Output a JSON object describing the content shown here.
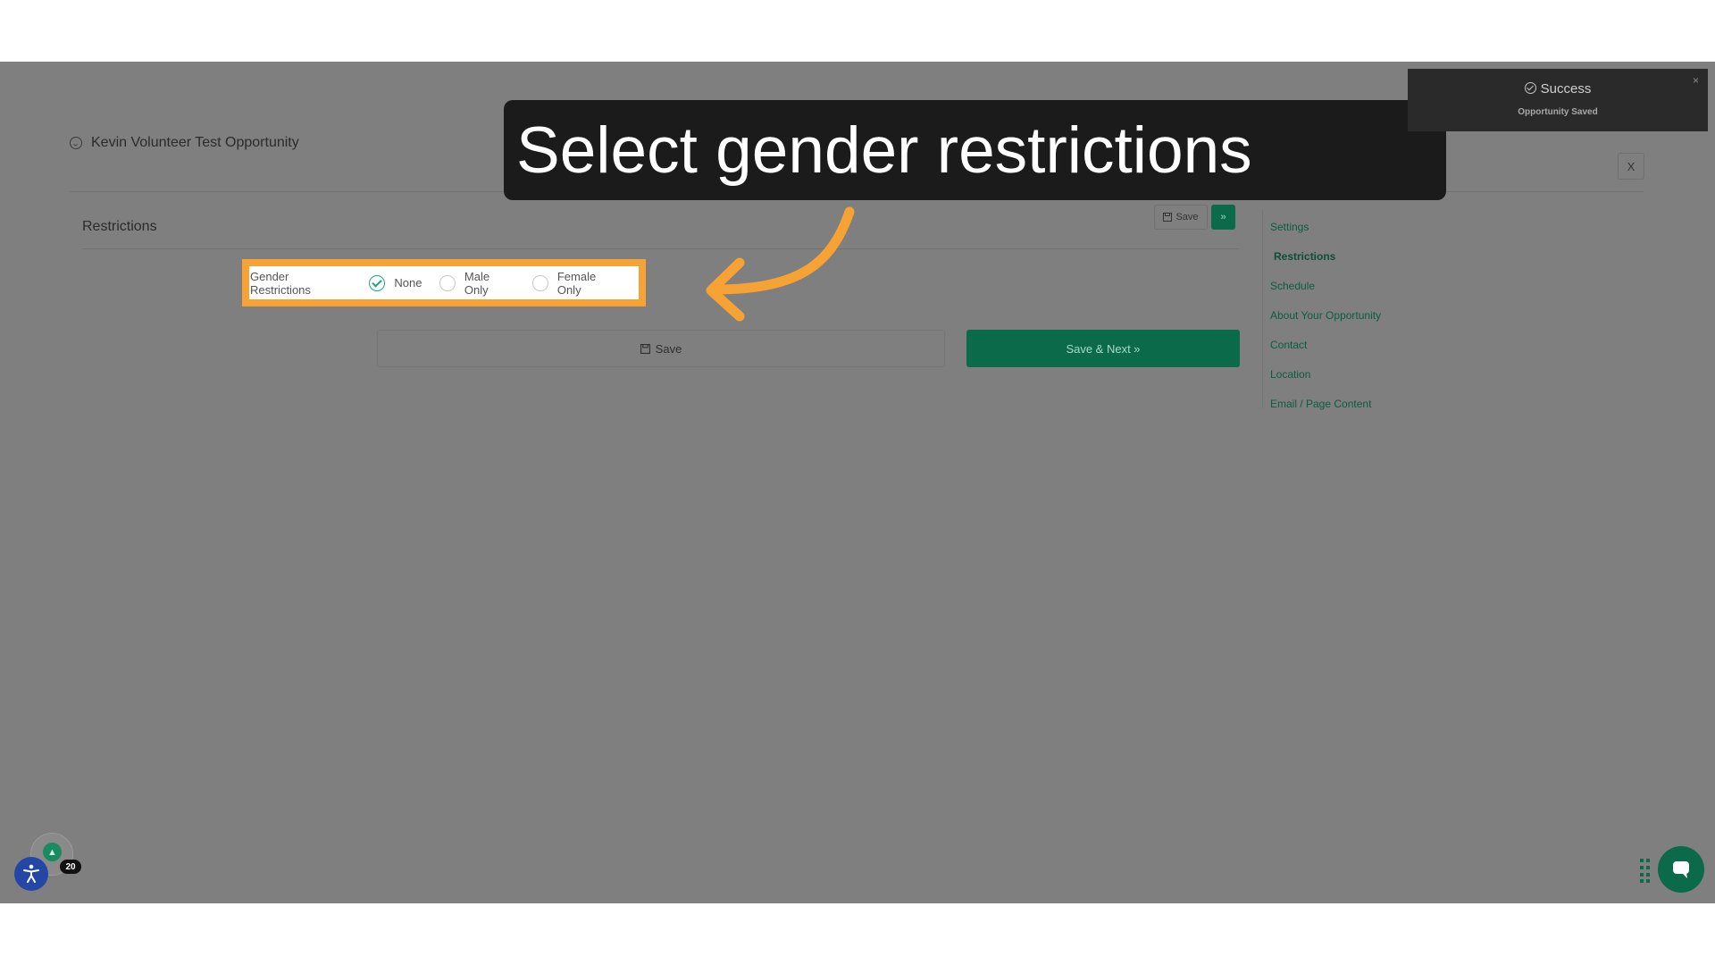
{
  "header": {
    "title": "Kevin Volunteer Test Opportunity",
    "close_label": "X"
  },
  "section": {
    "title": "Restrictions",
    "mini_save_label": "Save",
    "mini_next_label": "»"
  },
  "gender": {
    "label": "Gender Restrictions",
    "options": [
      {
        "label": "None",
        "checked": true
      },
      {
        "label": "Male Only",
        "checked": false
      },
      {
        "label": "Female Only",
        "checked": false
      }
    ]
  },
  "buttons": {
    "save_label": "Save",
    "save_next_label": "Save & Next »"
  },
  "side_nav": {
    "items": [
      {
        "label": "Settings"
      },
      {
        "label": "Restrictions"
      },
      {
        "label": "Schedule"
      },
      {
        "label": "About Your Opportunity"
      },
      {
        "label": "Contact"
      },
      {
        "label": "Location"
      },
      {
        "label": "Email / Page Content"
      }
    ]
  },
  "callout": {
    "text": "Select gender restrictions"
  },
  "toast": {
    "title": "Success",
    "message": "Opportunity Saved",
    "close_label": "×"
  },
  "widgets": {
    "count_badge": "20"
  },
  "colors": {
    "accent_green": "#0b6a4a",
    "highlight_orange": "#f7a234",
    "overlay_gray": "#7f7f7f"
  }
}
